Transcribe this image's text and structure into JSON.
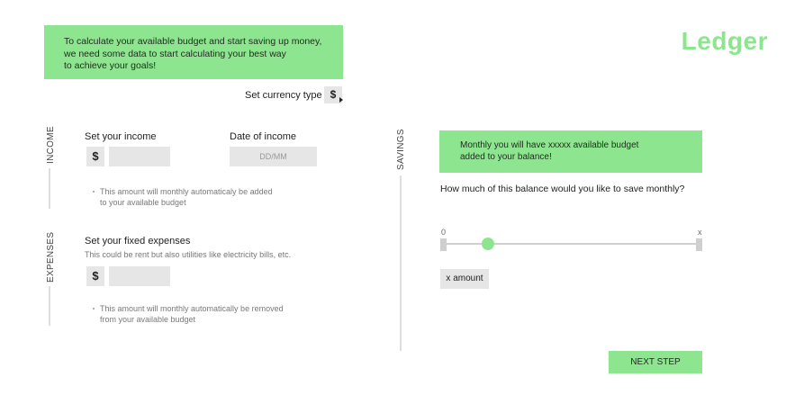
{
  "intro": {
    "line1": "To calculate your available budget and start saving up money,",
    "line2": "we need some data to start calculating your best way",
    "line3": "to achieve your goals!"
  },
  "brand": {
    "logo": "Ledger",
    "accent_color": "#8ee58f"
  },
  "currency": {
    "label": "Set currency type",
    "value": "$"
  },
  "income": {
    "section_label": "INCOME",
    "title": "Set your income",
    "currency_symbol": "$",
    "amount_value": "",
    "date_title": "Date of income",
    "date_placeholder": "DD/MM",
    "note_line1": "This amount will monthly automaticaly be added",
    "note_line2": "to your available budget"
  },
  "expenses": {
    "section_label": "EXPENSES",
    "title": "Set your fixed expenses",
    "subtitle": "This could be rent but also utilities like electricity bills, etc.",
    "currency_symbol": "$",
    "amount_value": "",
    "note_line1": "This amount will monthly automatically be removed",
    "note_line2": "from your available budget"
  },
  "savings": {
    "section_label": "SAVINGS",
    "monthly_line1": "Monthly you will have xxxxx available budget",
    "monthly_line2": "added to your balance!",
    "question": "How much of this balance would you like to save monthly?",
    "slider_min": "0",
    "slider_max": "x",
    "slider_fraction": 0.17,
    "amount_label": "x amount"
  },
  "next_button": "NEXT STEP"
}
